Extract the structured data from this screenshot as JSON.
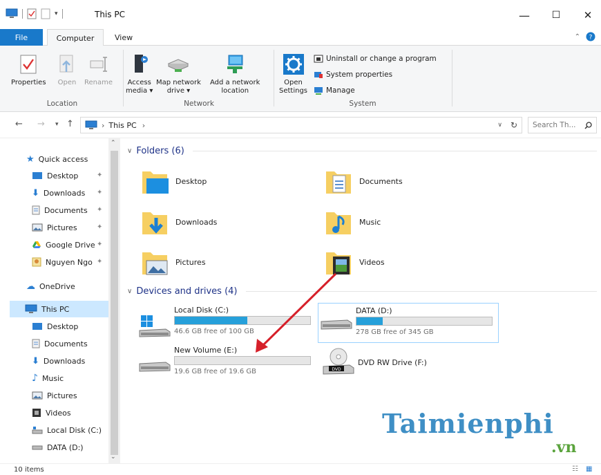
{
  "window": {
    "title": "This PC",
    "controls": {
      "minimize": "—",
      "maximize": "☐",
      "close": "✕"
    }
  },
  "tabs": {
    "file": "File",
    "computer": "Computer",
    "view": "View"
  },
  "ribbon": {
    "location": {
      "label": "Location",
      "properties": "Properties",
      "open": "Open",
      "rename": "Rename"
    },
    "network": {
      "label": "Network",
      "access_media": [
        "Access",
        "media ▾"
      ],
      "map_network_drive": [
        "Map network",
        "drive ▾"
      ],
      "add_network_location": [
        "Add a network",
        "location"
      ]
    },
    "system": {
      "label": "System",
      "open_settings": [
        "Open",
        "Settings"
      ],
      "uninstall": "Uninstall or change a program",
      "system_properties": "System properties",
      "manage": "Manage"
    }
  },
  "address": {
    "path_root": "This PC",
    "search_placeholder": "Search Th..."
  },
  "nav": {
    "quick_access": "Quick access",
    "qa_items": [
      "Desktop",
      "Downloads",
      "Documents",
      "Pictures",
      "Google Drive",
      "Nguyen Ngo"
    ],
    "onedrive": "OneDrive",
    "this_pc": "This PC",
    "pc_items": [
      "Desktop",
      "Documents",
      "Downloads",
      "Music",
      "Pictures",
      "Videos",
      "Local Disk (C:)",
      "DATA (D:)"
    ]
  },
  "folders": {
    "header": "Folders (6)",
    "items": [
      "Desktop",
      "Documents",
      "Downloads",
      "Music",
      "Pictures",
      "Videos"
    ]
  },
  "drives": {
    "header": "Devices and drives (4)",
    "items": [
      {
        "name": "Local Disk (C:)",
        "free": "46.6 GB free of 100 GB",
        "used_fraction": 0.534
      },
      {
        "name": "DATA (D:)",
        "free": "278 GB free of 345 GB",
        "used_fraction": 0.194
      },
      {
        "name": "New Volume (E:)",
        "free": "19.6 GB free of 19.6 GB",
        "used_fraction": 0.0
      },
      {
        "name": "DVD RW Drive (F:)"
      }
    ]
  },
  "status": {
    "count": "10 items"
  },
  "watermark": {
    "brand": "Taimienphi",
    "tld": ".vn"
  },
  "colors": {
    "accent": "#1979ca",
    "drive_bar": "#26a0da",
    "arrow": "#d6202a",
    "header_text": "#1e3287"
  }
}
